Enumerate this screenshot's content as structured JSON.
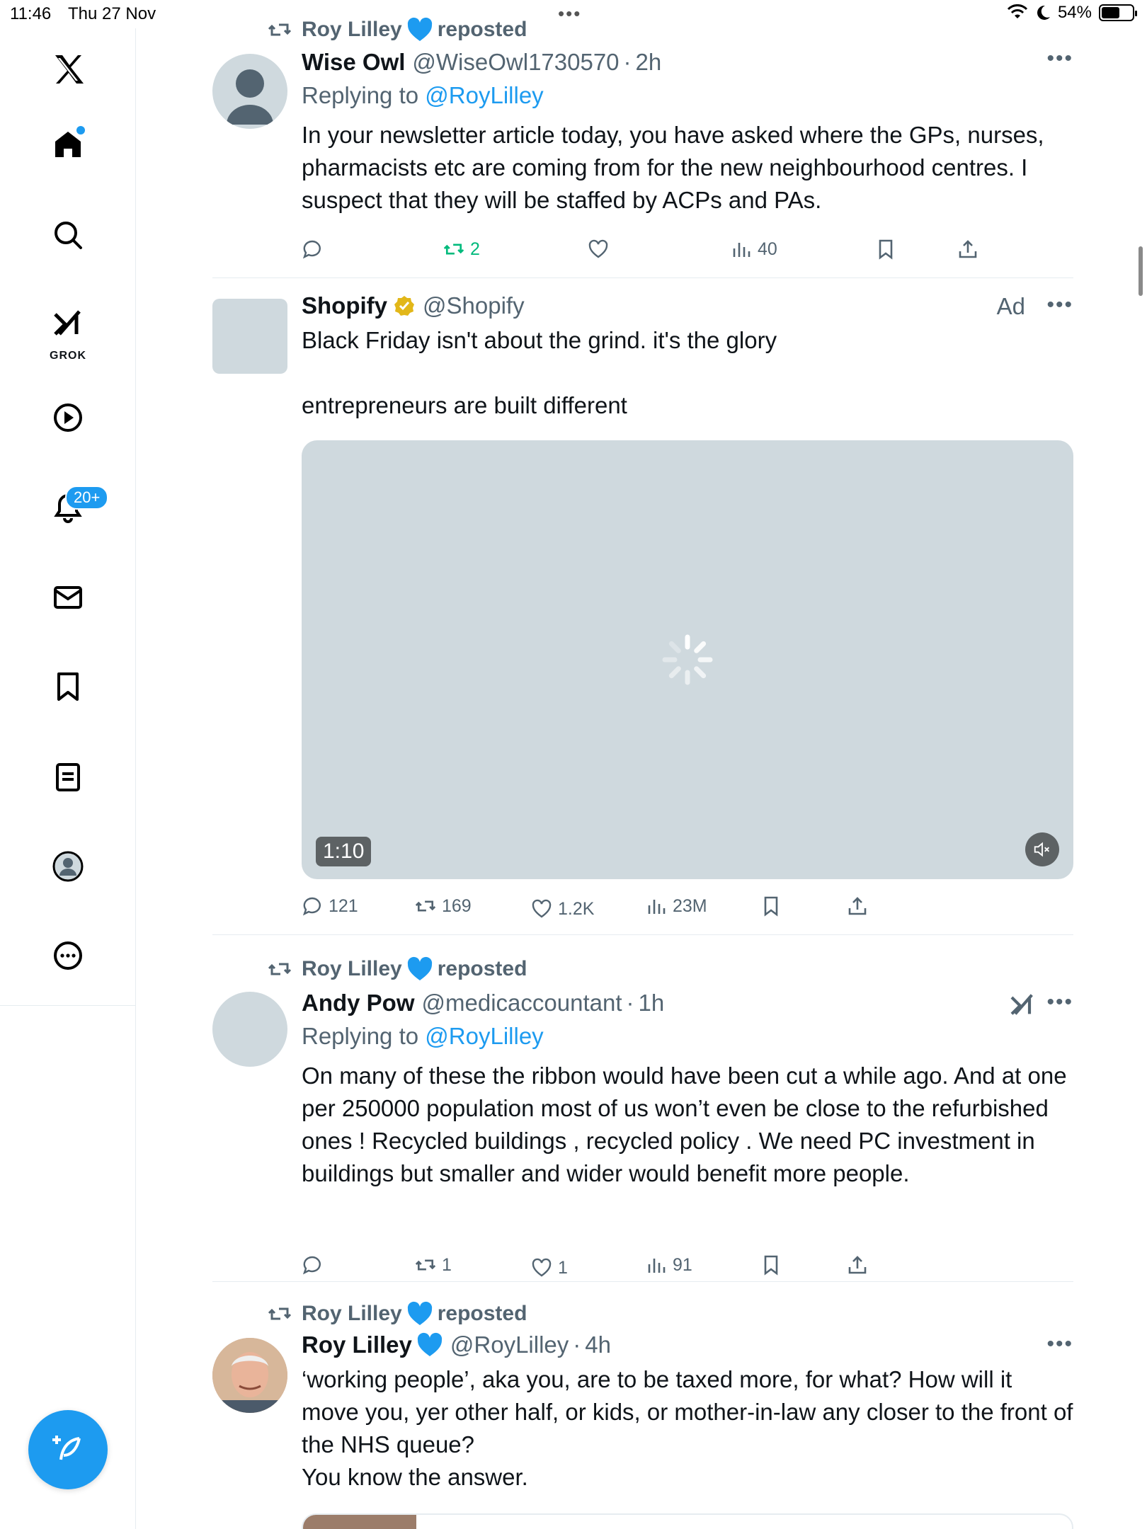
{
  "status_bar": {
    "time": "11:46",
    "date": "Thu 27 Nov",
    "battery": "54%"
  },
  "sidebar": {
    "grok_label": "GROK",
    "notifications_badge": "20+"
  },
  "tweets": [
    {
      "reposted_by": "Roy Lilley",
      "repost_suffix": "reposted",
      "display_name": "Wise Owl",
      "handle": "@WiseOwl1730570",
      "time": "2h",
      "replying_to_prefix": "Replying to",
      "replying_to": "@RoyLilley",
      "text": "In your newsletter article today, you have asked where the GPs, nurses, pharmacists etc are coming from for the new neighbourhood centres. I suspect that they will be staffed by ACPs and PAs.",
      "replies": "",
      "reposts": "2",
      "likes": "",
      "views": "40"
    },
    {
      "display_name": "Shopify",
      "handle": "@Shopify",
      "ad_label": "Ad",
      "text": "Black Friday isn't about the grind. it's the glory\n\nentrepreneurs are built different",
      "video_duration": "1:10",
      "replies": "121",
      "reposts": "169",
      "likes": "1.2K",
      "views": "23M"
    },
    {
      "reposted_by": "Roy Lilley",
      "repost_suffix": "reposted",
      "display_name": "Andy Pow",
      "handle": "@medicaccountant",
      "time": "1h",
      "replying_to_prefix": "Replying to",
      "replying_to": "@RoyLilley",
      "text": "On many of these the ribbon would have been cut a while ago. And at one per 250000 population most of us won’t even be close to the refurbished ones ! Recycled buildings , recycled policy . We need PC investment in buildings but smaller and wider would benefit more people.",
      "replies": "",
      "reposts": "1",
      "likes": "1",
      "views": "91"
    },
    {
      "reposted_by": "Roy Lilley",
      "repost_suffix": "reposted",
      "display_name": "Roy Lilley",
      "handle": "@RoyLilley",
      "time": "4h",
      "text": "‘working people’, aka you, are to be taxed more, for what? How will it move you, yer other half, or kids, or mother-in-law any closer to the front of the NHS queue?\nYou know the answer."
    }
  ],
  "colors": {
    "accent": "#1d9bf0",
    "repost_green": "#00ba7c",
    "muted": "#536471",
    "heart_blue": "#1d9bf0",
    "verified_gold": "#e2b719"
  },
  "icons": [
    "x-logo-icon",
    "home-icon",
    "search-icon",
    "grok-icon",
    "video-icon",
    "bell-icon",
    "mail-icon",
    "bookmark-icon",
    "list-icon",
    "profile-icon",
    "more-icon",
    "compose-icon",
    "reply-icon",
    "repost-icon",
    "like-icon",
    "views-icon",
    "share-icon"
  ]
}
